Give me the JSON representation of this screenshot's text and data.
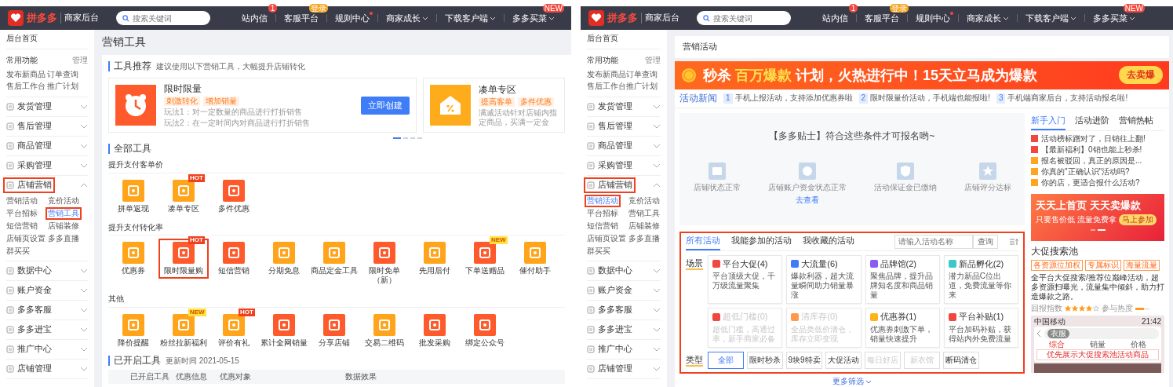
{
  "panels": [
    {
      "kind": "tools",
      "header": {
        "logo": "拼多多",
        "subtitle": "商家后台",
        "search": {
          "placeholder": "搜索关键词"
        },
        "nav": [
          {
            "label": "站内信",
            "badge": {
              "text": "1",
              "color": "#f0483e"
            },
            "dot": false,
            "caret": false
          },
          {
            "label": "客服平台",
            "badge": {
              "text": "登录",
              "color": "#f5a623"
            },
            "dot": false,
            "caret": false
          },
          {
            "label": "规则中心",
            "dot": true,
            "caret": false
          },
          {
            "label": "商家成长",
            "dot": false,
            "caret": true
          },
          {
            "label": "下载客户端",
            "dot": false,
            "caret": true
          },
          {
            "label": "多多买菜",
            "badge": {
              "text": "NEW",
              "color": "#f0483e"
            },
            "dot": false,
            "caret": true
          }
        ]
      },
      "sidebar": {
        "home": "后台首页",
        "common_title": "常用功能",
        "manage": "管理",
        "shortcuts": [
          "发布新商品",
          "订单查询",
          "售后工作台",
          "推广计划"
        ],
        "menus": [
          {
            "label": "发货管理",
            "expanded": false,
            "highlighted": false
          },
          {
            "label": "售后管理",
            "expanded": false,
            "highlighted": false
          },
          {
            "label": "商品管理",
            "expanded": false,
            "highlighted": false
          },
          {
            "label": "采购管理",
            "expanded": false,
            "highlighted": false
          },
          {
            "label": "店铺营销",
            "expanded": true,
            "highlighted": true,
            "children": [
              {
                "label": "营销活动",
                "selected": false,
                "highlighted": false
              },
              {
                "label": "竞价活动",
                "selected": false,
                "highlighted": false
              },
              {
                "label": "平台招标",
                "selected": false,
                "highlighted": false
              },
              {
                "label": "营销工具",
                "selected": true,
                "highlighted": true
              },
              {
                "label": "短信营销",
                "selected": false,
                "highlighted": false
              },
              {
                "label": "店铺装修",
                "selected": false,
                "highlighted": false
              },
              {
                "label": "店铺页设置",
                "selected": false,
                "highlighted": false
              },
              {
                "label": "多多直播",
                "selected": false,
                "highlighted": false
              },
              {
                "label": "群买买",
                "selected": false,
                "highlighted": false
              }
            ]
          },
          {
            "label": "数据中心",
            "expanded": false,
            "highlighted": false
          },
          {
            "label": "账户资金",
            "expanded": false,
            "highlighted": false
          },
          {
            "label": "多多客服",
            "expanded": false,
            "highlighted": false
          },
          {
            "label": "多多进宝",
            "expanded": false,
            "highlighted": false
          },
          {
            "label": "推广中心",
            "expanded": false,
            "highlighted": false
          },
          {
            "label": "店铺管理",
            "expanded": false,
            "highlighted": false
          }
        ]
      },
      "main": {
        "title": "营销工具",
        "recommend": {
          "title": "工具推荐",
          "hint": "建议使用以下营销工具，大幅提升店铺转化",
          "cards": [
            {
              "title": "限时限量",
              "color": "#ff5a2c",
              "tags": [
                "刺激转化",
                "增加销量"
              ],
              "lines": [
                "玩法1：对一定数量的商品进行打折销售",
                "玩法2：在一定时间内对商品进行打折销售"
              ],
              "button": "立即创建"
            },
            {
              "title": "凑单专区",
              "color": "#ffac1c",
              "tags": [
                "提高客单",
                "多件优惠"
              ],
              "lines": [
                "满减活动针对店铺内指定商品，买满一定金"
              ]
            }
          ],
          "pages": [
            {
              "selected": true
            },
            {
              "selected": false
            },
            {
              "selected": false
            },
            {
              "selected": false
            }
          ]
        },
        "all_tools": {
          "title": "全部工具",
          "groups": [
            {
              "title": "提升支付客单价",
              "tools": [
                {
                  "label": "拼单返现",
                  "color": "#ffa41b",
                  "highlighted": false
                },
                {
                  "label": "凑单专区",
                  "color": "#ffa41b",
                  "highlighted": false,
                  "badge": {
                    "text": "HOT",
                    "kind": "hot"
                  }
                },
                {
                  "label": "多件优惠",
                  "color": "#ff5a2c",
                  "highlighted": false
                }
              ]
            },
            {
              "title": "提升支付转化率",
              "tools": [
                {
                  "label": "优惠券",
                  "color": "#ffa41b",
                  "highlighted": false
                },
                {
                  "label": "限时限量购",
                  "color": "#ff5a2c",
                  "highlighted": true,
                  "badge": {
                    "text": "HOT",
                    "kind": "hot"
                  }
                },
                {
                  "label": "短信营销",
                  "color": "#ff5a2c",
                  "highlighted": false
                },
                {
                  "label": "分期免息",
                  "color": "#ffa41b",
                  "highlighted": false
                },
                {
                  "label": "商品定金工具",
                  "color": "#ffa41b",
                  "highlighted": false
                },
                {
                  "label": "限时免单（新）",
                  "color": "#ff5a2c",
                  "highlighted": false
                },
                {
                  "label": "先用后付",
                  "color": "#ffa41b",
                  "highlighted": false
                },
                {
                  "label": "下单送赠品",
                  "color": "#ff5a2c",
                  "highlighted": false,
                  "badge": {
                    "text": "NEW",
                    "kind": "new"
                  }
                },
                {
                  "label": "催付助手",
                  "color": "#ffa41b",
                  "highlighted": false
                }
              ]
            },
            {
              "title": "其他",
              "tools": [
                {
                  "label": "降价提醒",
                  "color": "#ffa41b",
                  "highlighted": false
                },
                {
                  "label": "粉丝拉新福利",
                  "color": "#ffa41b",
                  "highlighted": false,
                  "badge": {
                    "text": "NEW",
                    "kind": "new"
                  }
                },
                {
                  "label": "评价有礼",
                  "color": "#ffa41b",
                  "highlighted": false,
                  "badge": {
                    "text": "HOT",
                    "kind": "hot"
                  }
                },
                {
                  "label": "累计全网销量",
                  "color": "#ff5a2c",
                  "highlighted": false
                },
                {
                  "label": "分享店铺",
                  "color": "#ff5a2c",
                  "highlighted": false
                },
                {
                  "label": "交易二维码",
                  "color": "#ffa41b",
                  "highlighted": false
                },
                {
                  "label": "批发采购",
                  "color": "#ff5a2c",
                  "highlighted": false
                },
                {
                  "label": "绑定公众号",
                  "color": "#ff5a2c",
                  "highlighted": false
                }
              ]
            }
          ]
        },
        "enabled": {
          "title": "已开启工具",
          "updated": "更新时间 2021-05-15",
          "columns": [
            "已开启工具",
            "优惠信息",
            "优惠对象",
            "数据效果"
          ]
        }
      }
    },
    {
      "kind": "activities",
      "header": {
        "logo": "拼多多",
        "subtitle": "商家后台",
        "search": {
          "placeholder": "搜索关键词"
        },
        "nav": [
          {
            "label": "站内信",
            "badge": {
              "text": "1",
              "color": "#f0483e"
            },
            "dot": false,
            "caret": false
          },
          {
            "label": "客服平台",
            "badge": {
              "text": "登录",
              "color": "#f5a623"
            },
            "dot": false,
            "caret": false
          },
          {
            "label": "规则中心",
            "dot": true,
            "caret": false
          },
          {
            "label": "商家成长",
            "dot": false,
            "caret": true
          },
          {
            "label": "下载客户端",
            "dot": false,
            "caret": true
          },
          {
            "label": "多多买菜",
            "badge": {
              "text": "NEW",
              "color": "#f0483e"
            },
            "dot": false,
            "caret": true
          }
        ]
      },
      "sidebar": {
        "home": "后台首页",
        "common_title": "常用功能",
        "manage": "管理",
        "shortcuts": [
          "发布新商品",
          "订单查询",
          "售后工作台",
          "推广计划"
        ],
        "menus": [
          {
            "label": "发货管理",
            "expanded": false,
            "highlighted": false
          },
          {
            "label": "售后管理",
            "expanded": false,
            "highlighted": false
          },
          {
            "label": "商品管理",
            "expanded": false,
            "highlighted": false
          },
          {
            "label": "采购管理",
            "expanded": false,
            "highlighted": false
          },
          {
            "label": "店铺营销",
            "expanded": true,
            "highlighted": true,
            "children": [
              {
                "label": "营销活动",
                "selected": true,
                "highlighted": true
              },
              {
                "label": "竞价活动",
                "selected": false,
                "highlighted": false
              },
              {
                "label": "平台招标",
                "selected": false,
                "highlighted": false
              },
              {
                "label": "营销工具",
                "selected": false,
                "highlighted": false
              },
              {
                "label": "短信营销",
                "selected": false,
                "highlighted": false
              },
              {
                "label": "店铺装修",
                "selected": false,
                "highlighted": false
              },
              {
                "label": "店铺页设置",
                "selected": false,
                "highlighted": false
              },
              {
                "label": "多多直播",
                "selected": false,
                "highlighted": false
              },
              {
                "label": "群买买",
                "selected": false,
                "highlighted": false
              }
            ]
          },
          {
            "label": "数据中心",
            "expanded": false,
            "highlighted": false
          },
          {
            "label": "账户资金",
            "expanded": false,
            "highlighted": false
          },
          {
            "label": "多多客服",
            "expanded": false,
            "highlighted": false
          },
          {
            "label": "多多进宝",
            "expanded": false,
            "highlighted": false
          },
          {
            "label": "推广中心",
            "expanded": false,
            "highlighted": false
          },
          {
            "label": "店铺管理",
            "expanded": false,
            "highlighted": false
          }
        ]
      },
      "main": {
        "title": "营销活动",
        "banner": {
          "headline": "秒杀 **百万爆款** 计划，火热进行中！15天立马成为爆款",
          "button": "去卖爆"
        },
        "news": {
          "title": "活动新闻",
          "items": [
            {
              "index": "1",
              "text": "手机上报活动，支持添加优惠券啦"
            },
            {
              "index": "2",
              "text": "限时限量价活动，手机端也能报啦!"
            },
            {
              "index": "3",
              "text": "手机端商家后台，支持活动报名啦!"
            }
          ]
        },
        "tips": {
          "title": "【多多贴士】符合这些条件才可报名哟~",
          "items": [
            {
              "label": "店铺状态正常"
            },
            {
              "label": "店铺账户资金状态正常",
              "link": "去查看"
            },
            {
              "label": "活动保证金已缴纳"
            },
            {
              "label": "店铺评分达标"
            }
          ]
        },
        "activities": {
          "highlighted": true,
          "tabs": [
            {
              "label": "所有活动",
              "selected": true
            },
            {
              "label": "我能参加的活动",
              "selected": false
            },
            {
              "label": "我收藏的活动",
              "selected": false
            }
          ],
          "search": {
            "placeholder": "请输入活动名称",
            "button": "查询"
          },
          "scene_label": "场景",
          "scenes": [
            {
              "title": "平台大促(4)",
              "desc": "平台顶级大促，千万级流量聚集",
              "color": "#f0483e",
              "disabled": false
            },
            {
              "title": "大流量(6)",
              "desc": "爆款利器，超大流量瞬间助力销量暴涨",
              "color": "#3f7cf7",
              "disabled": false
            },
            {
              "title": "品牌馆(2)",
              "desc": "聚焦品牌，提升品牌知名度和商品销量",
              "color": "#8a5cf5",
              "disabled": false
            },
            {
              "title": "新品孵化(2)",
              "desc": "潜力新品C位出道，免费流量等你来",
              "color": "#3cc8c8",
              "disabled": false
            },
            {
              "title": "超低门槛(0)",
              "desc": "超低门槛，高通过率，新手商家必备",
              "color": "#f0483e",
              "disabled": true
            },
            {
              "title": "清库存(0)",
              "desc": "全品类低价清仓，库存立即变现",
              "color": "#ff9a4d",
              "disabled": true
            },
            {
              "title": "优惠券(1)",
              "desc": "优惠券刺激下单，销量快速提升",
              "color": "#ffb319",
              "disabled": false
            },
            {
              "title": "平台补贴(1)",
              "desc": "平台加码补贴，获得站内外免费流量",
              "color": "#f0483e",
              "disabled": false
            }
          ],
          "type_label": "类型",
          "types": [
            {
              "label": "全部",
              "selected": true,
              "disabled": false
            },
            {
              "label": "限时秒杀",
              "selected": false,
              "disabled": false
            },
            {
              "label": "9块9特卖",
              "selected": false,
              "disabled": false
            },
            {
              "label": "大促活动",
              "selected": false,
              "disabled": false
            },
            {
              "label": "每日好店",
              "selected": false,
              "disabled": true
            },
            {
              "label": "新衣馆",
              "selected": false,
              "disabled": true
            },
            {
              "label": "断码清仓",
              "selected": false,
              "disabled": false
            }
          ],
          "more": "更多筛选"
        },
        "help": {
          "tabs": [
            {
              "label": "新手入门",
              "selected": true
            },
            {
              "label": "活动进阶",
              "selected": false
            },
            {
              "label": "营销热帖",
              "selected": false
            }
          ],
          "posts": [
            {
              "text": "活动榜标蹭对了，日销往上翻!",
              "color": "#f0483e"
            },
            {
              "text": "【最新福利】0销也能上秒杀!",
              "color": "#f0483e"
            },
            {
              "text": "报名被驳回，真正的原因是...",
              "color": "#ffa51f"
            },
            {
              "text": "你真的\"正确认识\"活动吗?",
              "color": "#ffa51f"
            },
            {
              "text": "你的店，更适合报什么活动?",
              "color": "#ffa51f"
            }
          ]
        },
        "promo": {
          "headline": "天天上首页 天天卖爆款",
          "sub": "只要售价低 流量免费拿",
          "button": "马上参加",
          "pages": [
            {
              "selected": false
            },
            {
              "selected": true
            }
          ]
        },
        "feature": {
          "title": "大促搜索池",
          "tags": [
            "各资源位加权",
            "专属标识",
            "海量流量"
          ],
          "desc": "全平台大促搜索/推荐位巅峰活动，超多资源扫曝光，流量集中倾斜，助力打造爆款之路。",
          "rating_label": "回报指数",
          "stars": 4,
          "heat_label": "参与热度",
          "heat": {
            "level": 0.6
          },
          "phone": {
            "carrier": "中国移动",
            "time": "21:42",
            "chip": "衣服",
            "sorts": [
              "综合",
              "销量",
              "价格"
            ],
            "notice": "优先展示大促搜索池活动商品"
          }
        }
      }
    }
  ]
}
